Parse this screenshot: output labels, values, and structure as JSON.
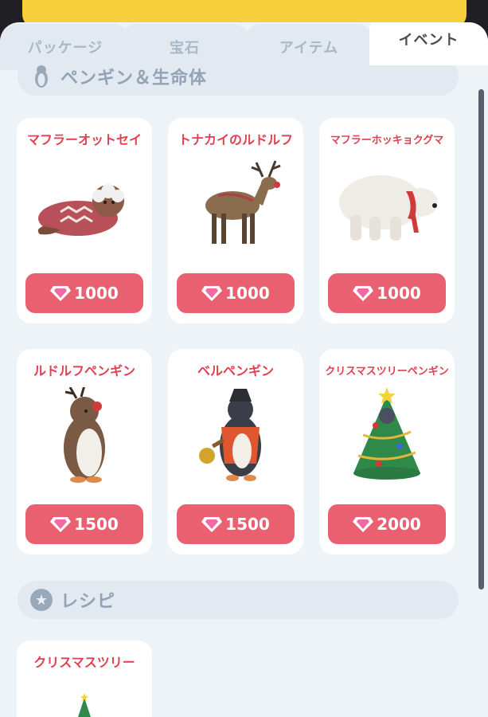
{
  "tabs": [
    {
      "label": "パッケージ"
    },
    {
      "label": "宝石"
    },
    {
      "label": "アイテム"
    },
    {
      "label": "イベント",
      "active": true
    }
  ],
  "sections": [
    {
      "title": "ペンギン＆生命体",
      "icon": "penguin-icon",
      "items": [
        {
          "name": "マフラーオットセイ",
          "price": "1000",
          "icon": "seal-in-sweater"
        },
        {
          "name": "トナカイのルドルフ",
          "price": "1000",
          "icon": "reindeer"
        },
        {
          "name": "マフラーホッキョクグマ",
          "price": "1000",
          "icon": "polar-bear-with-scarf"
        },
        {
          "name": "ルドルフペンギン",
          "price": "1500",
          "icon": "reindeer-penguin"
        },
        {
          "name": "ベルペンギン",
          "price": "1500",
          "icon": "bell-penguin"
        },
        {
          "name": "クリスマスツリーペンギン",
          "price": "2000",
          "icon": "christmas-tree-penguin"
        }
      ]
    },
    {
      "title": "レシピ",
      "icon": "star-badge-icon",
      "items": [
        {
          "name": "クリスマスツリー",
          "icon": "christmas-tree"
        }
      ]
    }
  ],
  "colors": {
    "accent_button": "#e96070",
    "card_title": "#e0404f",
    "top_bar": "#f7cf3d",
    "section_header_bg": "#e2e9f1"
  },
  "currency_icon": "gem-icon"
}
